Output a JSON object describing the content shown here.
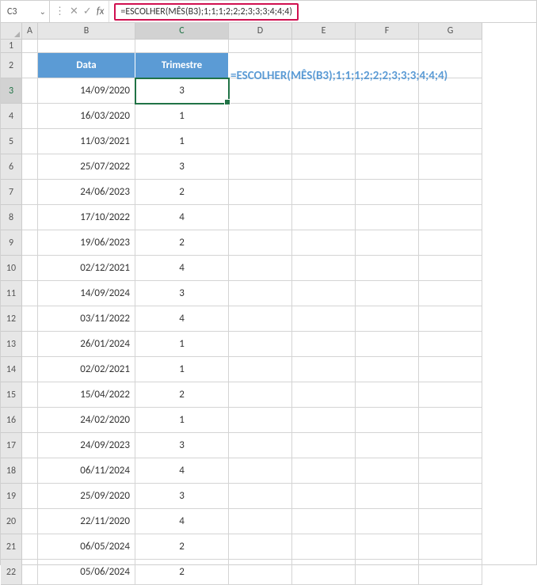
{
  "formulaBar": {
    "nameBox": "C3",
    "formula": "=ESCOLHER(MÊS(B3);1;1;1;2;2;2;3;3;3;4;4;4)"
  },
  "columns": [
    "A",
    "B",
    "C",
    "D",
    "E",
    "F",
    "G"
  ],
  "rowHeaders": [
    "1",
    "2",
    "3",
    "4",
    "5",
    "6",
    "7",
    "8",
    "9",
    "10",
    "11",
    "12",
    "13",
    "14",
    "15",
    "16",
    "17",
    "18",
    "19",
    "20",
    "21",
    "22"
  ],
  "tableHeaders": {
    "col1": "Data",
    "col2": "Trimestre"
  },
  "annotation": "=ESCOLHER(MÊS(B3);1;1;1;2;2;2;3;3;3;4;4;4)",
  "chart_data": {
    "type": "table",
    "columns": [
      "Data",
      "Trimestre"
    ],
    "rows": [
      {
        "data": "14/09/2020",
        "trimestre": "3"
      },
      {
        "data": "16/03/2020",
        "trimestre": "1"
      },
      {
        "data": "11/03/2021",
        "trimestre": "1"
      },
      {
        "data": "25/07/2022",
        "trimestre": "3"
      },
      {
        "data": "24/06/2023",
        "trimestre": "2"
      },
      {
        "data": "17/10/2022",
        "trimestre": "4"
      },
      {
        "data": "19/06/2023",
        "trimestre": "2"
      },
      {
        "data": "02/12/2021",
        "trimestre": "4"
      },
      {
        "data": "14/09/2024",
        "trimestre": "3"
      },
      {
        "data": "03/11/2022",
        "trimestre": "4"
      },
      {
        "data": "26/01/2024",
        "trimestre": "1"
      },
      {
        "data": "02/02/2021",
        "trimestre": "1"
      },
      {
        "data": "15/04/2022",
        "trimestre": "2"
      },
      {
        "data": "24/02/2020",
        "trimestre": "1"
      },
      {
        "data": "24/09/2023",
        "trimestre": "3"
      },
      {
        "data": "06/11/2024",
        "trimestre": "4"
      },
      {
        "data": "25/09/2020",
        "trimestre": "3"
      },
      {
        "data": "22/11/2020",
        "trimestre": "4"
      },
      {
        "data": "06/05/2024",
        "trimestre": "2"
      },
      {
        "data": "05/06/2024",
        "trimestre": "2"
      }
    ]
  }
}
